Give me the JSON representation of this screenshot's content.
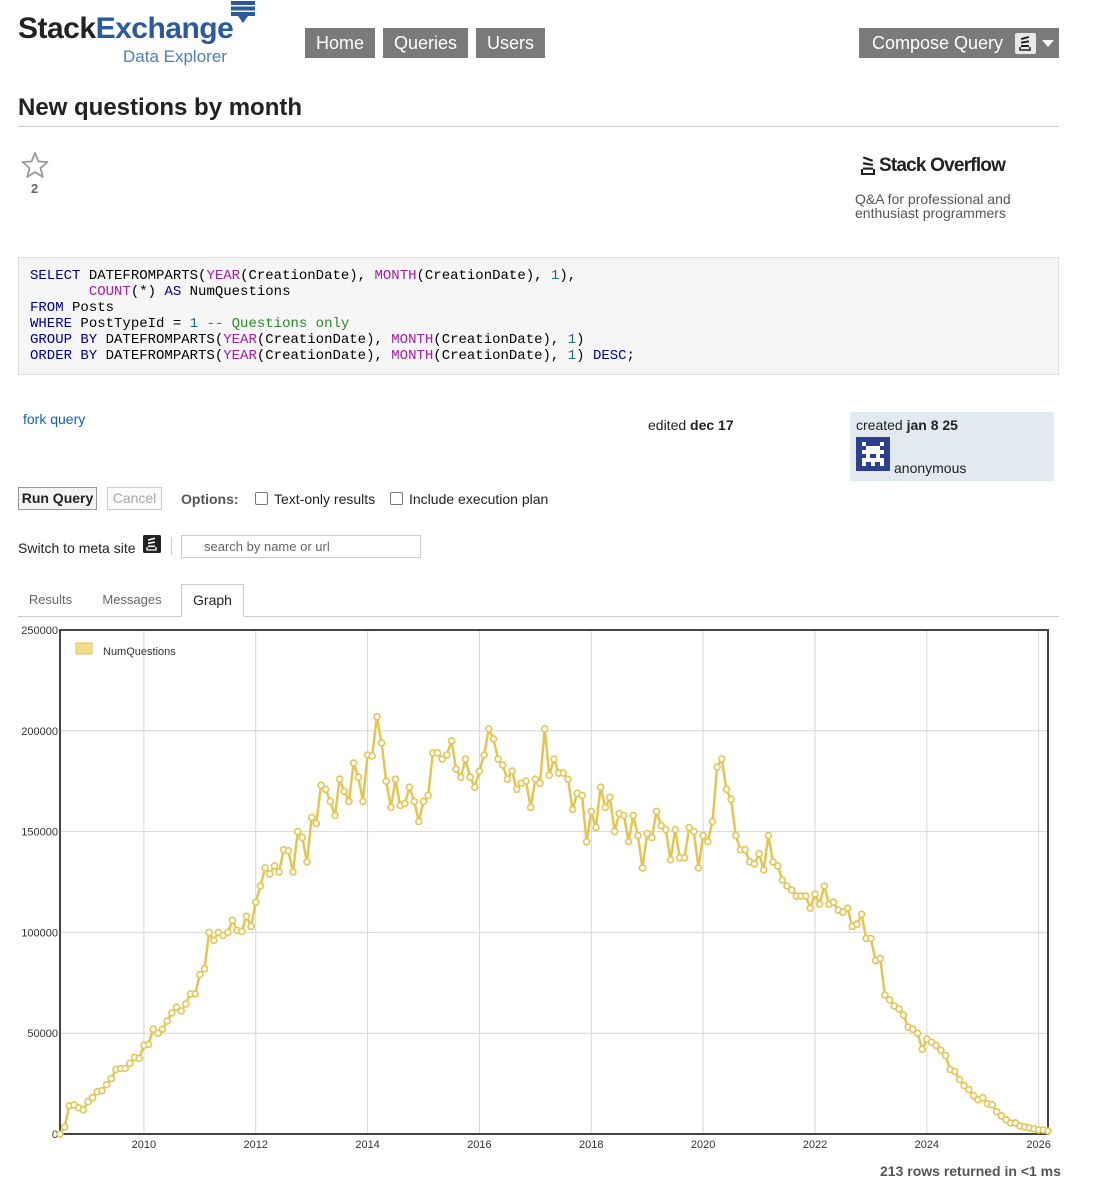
{
  "header": {
    "logo_main_1": "Stack",
    "logo_main_2": "Exchange",
    "logo_sub": "Data Explorer",
    "nav": [
      "Home",
      "Queries",
      "Users"
    ],
    "compose": "Compose Query"
  },
  "page": {
    "title": "New questions by month",
    "favorite_count": "2"
  },
  "site": {
    "name": "Stack Overflow",
    "description": "Q&A for professional and enthusiast programmers"
  },
  "query": {
    "sql": "SELECT DATEFROMPARTS(YEAR(CreationDate), MONTH(CreationDate), 1),\n       COUNT(*) AS NumQuestions\nFROM Posts\nWHERE PostTypeId = 1 -- Questions only\nGROUP BY DATEFROMPARTS(YEAR(CreationDate), MONTH(CreationDate), 1)\nORDER BY DATEFROMPARTS(YEAR(CreationDate), MONTH(CreationDate), 1) DESC;",
    "fork_label": "fork query",
    "edited_prefix": "edited",
    "edited_date": "dec 17",
    "created_prefix": "created",
    "created_date": "jan 8 25",
    "author": "anonymous"
  },
  "controls": {
    "run_label": "Run Query",
    "cancel_label": "Cancel",
    "options_label": "Options:",
    "text_only_label": "Text-only results",
    "exec_plan_label": "Include execution plan",
    "switch_meta_label": "Switch to meta site",
    "search_placeholder": "search by name or url"
  },
  "tabs": {
    "results": "Results",
    "messages": "Messages",
    "graph": "Graph",
    "active": "Graph"
  },
  "footer": {
    "rows_info": "213 rows returned in <1 ms"
  },
  "colors": {
    "series": "#e6c454",
    "series_fill": "#f1dc8c",
    "nav_button": "#7a7a7a",
    "link": "#1060b0"
  },
  "chart_data": {
    "type": "line",
    "title": "",
    "xlabel": "",
    "ylabel": "",
    "x_start": "2008-07",
    "x_step": "1 month",
    "xlim": [
      "2008-07",
      "2026-03"
    ],
    "ylim": [
      0,
      250000
    ],
    "y_ticks": [
      0,
      50000,
      100000,
      150000,
      200000,
      250000
    ],
    "x_ticks": [
      "2010",
      "2012",
      "2014",
      "2016",
      "2018",
      "2020",
      "2022",
      "2024",
      "2026"
    ],
    "grid": true,
    "legend": "top-left",
    "series": [
      {
        "name": "NumQuestions",
        "values": [
          0,
          3500,
          14000,
          14500,
          13000,
          12000,
          16000,
          18000,
          21000,
          21500,
          24500,
          27500,
          32000,
          32500,
          32500,
          35000,
          38000,
          37500,
          44000,
          44500,
          52000,
          50000,
          52000,
          56000,
          60000,
          63000,
          61000,
          64500,
          69500,
          69500,
          79000,
          82000,
          100000,
          96000,
          100000,
          98500,
          100000,
          106000,
          101000,
          100500,
          108000,
          103000,
          115000,
          123000,
          132000,
          129000,
          133000,
          130000,
          141000,
          140500,
          130000,
          150000,
          147000,
          135000,
          157000,
          154000,
          173000,
          171000,
          165000,
          158000,
          176000,
          170000,
          165000,
          184000,
          177000,
          165000,
          188000,
          187500,
          207000,
          194000,
          175000,
          162000,
          176000,
          163000,
          164000,
          172000,
          165000,
          155000,
          165000,
          168000,
          189000,
          189000,
          186000,
          188000,
          195000,
          181000,
          177000,
          186000,
          177000,
          172000,
          180000,
          188000,
          201000,
          196000,
          186000,
          183000,
          176000,
          180000,
          171000,
          174000,
          175000,
          162000,
          176000,
          174000,
          201000,
          178000,
          186000,
          179000,
          179000,
          176000,
          161000,
          169000,
          168000,
          145000,
          160000,
          152000,
          172000,
          162000,
          167000,
          150000,
          159000,
          158000,
          145000,
          158000,
          148000,
          132000,
          149000,
          147000,
          160000,
          153000,
          151000,
          136000,
          151000,
          137000,
          137000,
          152000,
          150000,
          132000,
          148000,
          145000,
          155000,
          182000,
          186000,
          171000,
          166000,
          148000,
          141000,
          141000,
          135000,
          134000,
          139000,
          131000,
          148000,
          135000,
          133000,
          126000,
          123000,
          121000,
          118000,
          118000,
          118000,
          112000,
          119000,
          114000,
          123000,
          114000,
          115000,
          111000,
          110000,
          112000,
          103000,
          104000,
          109000,
          97000,
          97000,
          86000,
          87000,
          69000,
          66500,
          63500,
          62000,
          59000,
          53000,
          52000,
          50000,
          42000,
          47000,
          45500,
          44000,
          41500,
          39000,
          32000,
          31000,
          27000,
          24000,
          22000,
          19000,
          17000,
          18000,
          15000,
          14500,
          11000,
          9000,
          7000,
          5500,
          5500,
          4000,
          3500,
          3000,
          2500,
          2000,
          2000,
          1500
        ]
      }
    ]
  }
}
